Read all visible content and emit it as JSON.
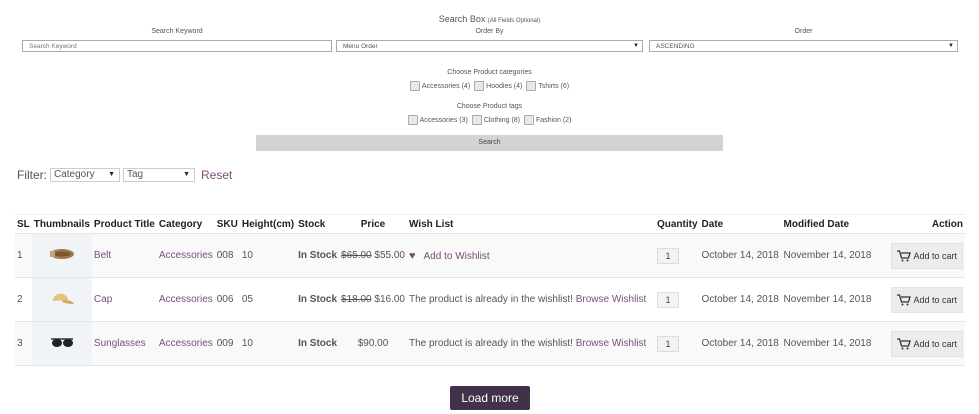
{
  "search_box": {
    "title": "Search Box",
    "title_note": "(All Fields Optional)",
    "keyword_label": "Search Keyword",
    "keyword_placeholder": "Search Keyword",
    "order_by_label": "Order By",
    "order_by_value": "Menu Order",
    "order_label": "Order",
    "order_value": "ASCENDING",
    "categories_heading": "Choose Product categories",
    "categories": [
      "Accessories (4)",
      "Hoodies (4)",
      "Tshirts (6)"
    ],
    "tags_heading": "Choose Product tags",
    "tags": [
      "Accessories (3)",
      "Clothing (8)",
      "Fashion (2)"
    ],
    "search_button": "Search"
  },
  "filter": {
    "label": "Filter:",
    "category_select": "Category",
    "tag_select": "Tag",
    "reset": "Reset"
  },
  "table": {
    "headers": [
      "SL",
      "Thumbnails",
      "Product Title",
      "Category",
      "SKU",
      "Height(cm)",
      "Stock",
      "Price",
      "Wish List",
      "Quantity",
      "Date",
      "Modified Date",
      "Action"
    ],
    "rows": [
      {
        "sl": "1",
        "thumb_icon": "belt-icon",
        "title": "Belt",
        "category": "Accessories",
        "sku": "008",
        "height": "10",
        "stock": "In Stock",
        "old_price": "$65.00",
        "price": "$55.00",
        "wish_action": "Add to Wishlist",
        "wish_text": "",
        "wish_link": "",
        "qty": "1",
        "date": "October 14, 2018",
        "modified": "November 14, 2018",
        "action": "Add to cart"
      },
      {
        "sl": "2",
        "thumb_icon": "cap-icon",
        "title": "Cap",
        "category": "Accessories",
        "sku": "006",
        "height": "05",
        "stock": "In Stock",
        "old_price": "$18.00",
        "price": "$16.00",
        "wish_action": "",
        "wish_text": "The product is already in the wishlist!",
        "wish_link": "Browse Wishlist",
        "qty": "1",
        "date": "October 14, 2018",
        "modified": "November 14, 2018",
        "action": "Add to cart"
      },
      {
        "sl": "3",
        "thumb_icon": "sunglasses-icon",
        "title": "Sunglasses",
        "category": "Accessories",
        "sku": "009",
        "height": "10",
        "stock": "In Stock",
        "old_price": "",
        "price": "$90.00",
        "wish_action": "",
        "wish_text": "The product is already in the wishlist!",
        "wish_link": "Browse Wishlist",
        "qty": "1",
        "date": "October 14, 2018",
        "modified": "November 14, 2018",
        "action": "Add to cart"
      }
    ]
  },
  "load_more": "Load more",
  "colors": {
    "accent": "#7b4f7b",
    "stock": "#3a9a3a",
    "button_dark": "#43304b"
  }
}
